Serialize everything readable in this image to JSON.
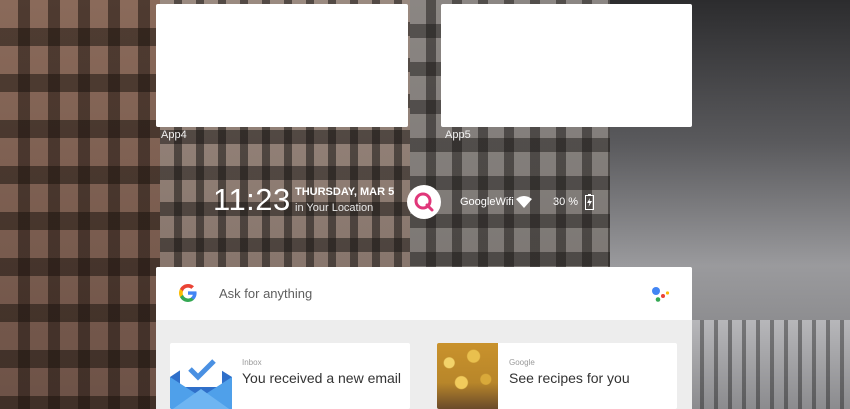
{
  "apps": [
    {
      "label": "App4"
    },
    {
      "label": "App5"
    }
  ],
  "status": {
    "time": "11:23",
    "date": "THURSDAY, MAR 5",
    "location": "in Your Location",
    "wifi": "GoogleWifi",
    "battery": "30 %"
  },
  "search": {
    "placeholder": "Ask for anything"
  },
  "cards": [
    {
      "source": "Inbox",
      "title": "You received a new email",
      "icon": "inbox-envelope-icon"
    },
    {
      "source": "Google",
      "title": "See recipes for you",
      "icon": "recipe-thumbnail"
    }
  ],
  "colors": {
    "assistant_pink": "#e0377a",
    "google_blue": "#4285f4",
    "google_red": "#ea4335",
    "google_yellow": "#fbbc05",
    "google_green": "#34a853"
  }
}
